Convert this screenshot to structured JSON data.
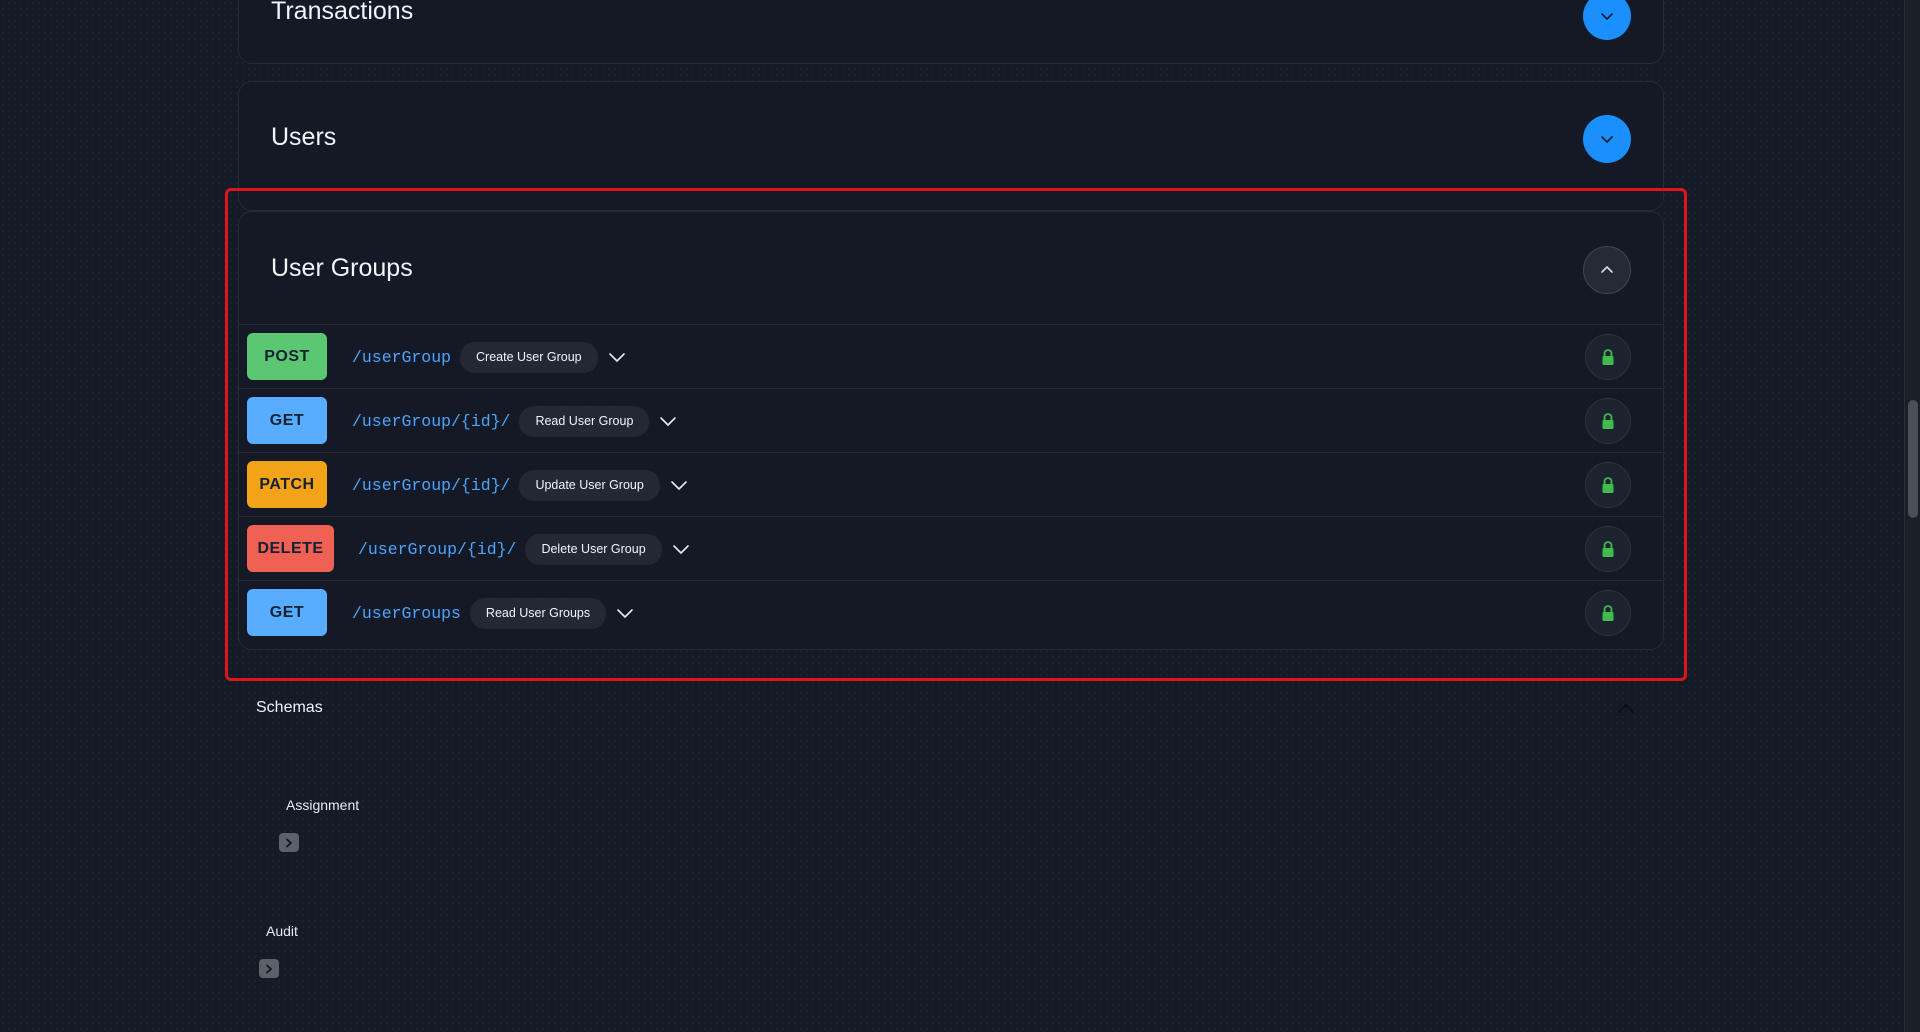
{
  "sections": {
    "transactions": {
      "title": "Transactions"
    },
    "users": {
      "title": "Users"
    },
    "user_groups": {
      "title": "User Groups",
      "operations": [
        {
          "method": "POST",
          "path": "/userGroup",
          "summary": "Create User Group"
        },
        {
          "method": "GET",
          "path": "/userGroup/{id}/",
          "summary": "Read User Group"
        },
        {
          "method": "PATCH",
          "path": "/userGroup/{id}/",
          "summary": "Update User Group"
        },
        {
          "method": "DELETE",
          "path": "/userGroup/{id}/",
          "summary": "Delete User Group"
        },
        {
          "method": "GET",
          "path": "/userGroups",
          "summary": "Read User Groups"
        }
      ]
    }
  },
  "schemas": {
    "title": "Schemas",
    "items": [
      {
        "name": "Assignment"
      },
      {
        "name": "Audit"
      }
    ]
  },
  "icons": {
    "toggle_collapsed": "chevron-down-icon",
    "toggle_expanded": "chevron-up-icon",
    "operation_expand": "chevron-down-icon",
    "authorize": "lock-icon",
    "schema_expand": "chevron-right-icon"
  },
  "colors": {
    "accent_blue": "#1a90ff",
    "post": "#5cc772",
    "get": "#57adff",
    "patch": "#f3a317",
    "delete": "#ef6152",
    "path_text": "#4ca4ff",
    "lock": "#3fb950",
    "highlight_border": "#e0141b"
  }
}
